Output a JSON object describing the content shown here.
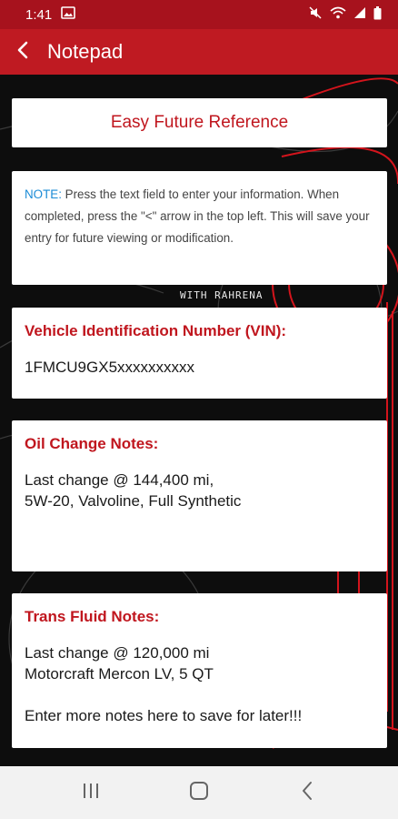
{
  "status_bar": {
    "time": "1:41",
    "icons": [
      "image-icon",
      "mute-icon",
      "wifi-icon",
      "signal-icon",
      "battery-icon"
    ]
  },
  "app_bar": {
    "title": "Notepad",
    "back_icon": "chevron-left-icon"
  },
  "reference_card": {
    "label": "Easy Future Reference"
  },
  "note_card": {
    "label": "NOTE:",
    "text": " Press the text field to enter your information. When completed, press the \"<\" arrow in the top left. This will save your entry for future viewing or modification."
  },
  "watermark": "WITH RAHRENA",
  "vin_card": {
    "heading": "Vehicle Identification Number (VIN):",
    "value": "1FMCU9GX5xxxxxxxxxx"
  },
  "oil_card": {
    "heading": "Oil Change Notes:",
    "value": "Last change @ 144,400 mi,\n5W-20, Valvoline, Full Synthetic"
  },
  "trans_card": {
    "heading": "Trans Fluid Notes:",
    "value": "Last change @ 120,000 mi\nMotorcraft Mercon LV, 5 QT\n\nEnter more notes here to save for later!!!"
  },
  "nav_bar": {
    "icons": [
      "recents-icon",
      "home-icon",
      "back-icon"
    ]
  },
  "colors": {
    "status_bar": "#a7121d",
    "app_bar": "#bf1a22",
    "accent_red": "#c0161e",
    "note_blue": "#1a8bd6",
    "background": "#0d0d0d"
  }
}
